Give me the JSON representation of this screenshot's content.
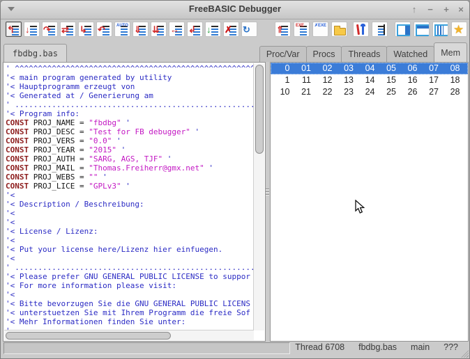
{
  "window": {
    "title": "FreeBASIC Debugger",
    "controls": {
      "shade": "↑",
      "minimize": "−",
      "maximize": "+",
      "close": "×"
    }
  },
  "toolbar": {
    "buttons": [
      {
        "name": "current-statement-button",
        "kind": "bars",
        "glyph": "↰",
        "color": "#d22b2b",
        "pressed": true
      },
      {
        "name": "step-into-button",
        "kind": "bars",
        "glyph": "↓",
        "color": "#d22b2b"
      },
      {
        "name": "step-over-button",
        "kind": "bars",
        "glyph": "↷",
        "color": "#d22b2b"
      },
      {
        "name": "step-multi-button",
        "kind": "bars",
        "glyph": "⇄",
        "color": "#d22b2b"
      },
      {
        "name": "step-to-line-button",
        "kind": "bars",
        "glyph": "↳",
        "color": "#d22b2b"
      },
      {
        "name": "step-return-button",
        "kind": "bars",
        "glyph": "↶",
        "color": "#d22b2b"
      },
      {
        "name": "auto-step-button",
        "kind": "bars",
        "glyph": "AUTO",
        "color": "#2b62d9",
        "small": true
      },
      {
        "name": "run-button",
        "kind": "bars",
        "glyph": "⇓",
        "color": "#d22b2b"
      },
      {
        "name": "run-to-cursor-button",
        "kind": "bars",
        "glyph": "⇊",
        "color": "#d22b2b"
      },
      {
        "name": "run-until-return-button",
        "kind": "bars",
        "glyph": "↔",
        "color": "#d22b2b"
      },
      {
        "name": "step-out-button",
        "kind": "bars",
        "glyph": "↲",
        "color": "#d22b2b"
      },
      {
        "name": "continue-run-button",
        "kind": "bars",
        "glyph": "↓",
        "color": "#1f9e3a"
      },
      {
        "name": "stop-debugging-button",
        "kind": "bars",
        "glyph": "✗",
        "color": "#cc1111"
      },
      {
        "name": "restart-button",
        "kind": "plain",
        "glyph": "↻",
        "color": "#2b73c8"
      },
      {
        "name": "attach-process-button",
        "kind": "bars",
        "glyph": "⇑",
        "color": "#d22b2b"
      },
      {
        "name": "run-exe-button",
        "kind": "bars",
        "glyph": "EXE",
        "color": "#d22b2b",
        "small": true
      },
      {
        "name": "kill-exe-button",
        "kind": "plain",
        "glyph": "✗EXE",
        "color": "#2b62d9",
        "small": true
      },
      {
        "name": "open-file-button",
        "kind": "folder"
      },
      {
        "name": "settings-tools-button",
        "kind": "tools"
      },
      {
        "name": "log-options-button",
        "kind": "notes"
      },
      {
        "name": "layout-right-pane-button",
        "kind": "win",
        "variant": "right"
      },
      {
        "name": "layout-top-pane-button",
        "kind": "win",
        "variant": "top"
      },
      {
        "name": "layout-columns-button",
        "kind": "win",
        "variant": "cols"
      },
      {
        "name": "favorites-button",
        "kind": "star",
        "glyph": "★"
      }
    ]
  },
  "tabs": {
    "source": {
      "label": "fbdbg.bas"
    },
    "right": [
      {
        "label": "Proc/Var",
        "active": false
      },
      {
        "label": "Procs",
        "active": false
      },
      {
        "label": "Threads",
        "active": false
      },
      {
        "label": "Watched",
        "active": false
      },
      {
        "label": "Mem",
        "active": true
      }
    ]
  },
  "editor": {
    "lines": [
      [
        [
          "com",
          "' ^^^^^^^^^^^^^^^^^^^^^^^^^^^^^^^^^^^^^^^^^^^^^^^^^^^^^^^^^^^^^^^^^^^^"
        ]
      ],
      [
        [
          "com",
          "'< main program generated by utility"
        ]
      ],
      [
        [
          "com",
          "'< Hauptprogramm erzeugt von"
        ]
      ],
      [
        [
          "com",
          "'< Generated at / Generierung am"
        ]
      ],
      [
        [
          "com",
          "' ......................................................................"
        ]
      ],
      [
        [
          "com",
          "'< Program info:"
        ]
      ],
      [
        [
          "kw",
          "CONST"
        ],
        [
          "txt",
          " PROJ_NAME = "
        ],
        [
          "str",
          "\"fbdbg\""
        ],
        [
          "com",
          " '"
        ]
      ],
      [
        [
          "kw",
          "CONST"
        ],
        [
          "txt",
          " PROJ_DESC = "
        ],
        [
          "str",
          "\"Test for FB debugger\""
        ],
        [
          "com",
          " '"
        ]
      ],
      [
        [
          "kw",
          "CONST"
        ],
        [
          "txt",
          " PROJ_VERS = "
        ],
        [
          "str",
          "\"0.0\""
        ],
        [
          "com",
          " '"
        ]
      ],
      [
        [
          "kw",
          "CONST"
        ],
        [
          "txt",
          " PROJ_YEAR = "
        ],
        [
          "str",
          "\"2015\""
        ],
        [
          "com",
          " '"
        ]
      ],
      [
        [
          "kw",
          "CONST"
        ],
        [
          "txt",
          " PROJ_AUTH = "
        ],
        [
          "str",
          "\"SARG, AGS, TJF\""
        ],
        [
          "com",
          " '"
        ]
      ],
      [
        [
          "kw",
          "CONST"
        ],
        [
          "txt",
          " PROJ_MAIL = "
        ],
        [
          "str",
          "\"Thomas.Freiherr@gmx.net\""
        ],
        [
          "com",
          " '"
        ]
      ],
      [
        [
          "kw",
          "CONST"
        ],
        [
          "txt",
          " PROJ_WEBS = "
        ],
        [
          "str",
          "\"\""
        ],
        [
          "com",
          " '"
        ]
      ],
      [
        [
          "kw",
          "CONST"
        ],
        [
          "txt",
          " PROJ_LICE = "
        ],
        [
          "str",
          "\"GPLv3\""
        ],
        [
          "com",
          " '"
        ]
      ],
      [
        [
          "com",
          "'<"
        ]
      ],
      [
        [
          "com",
          "'< Description / Beschreibung:"
        ]
      ],
      [
        [
          "com",
          "'<"
        ]
      ],
      [
        [
          "com",
          "'<"
        ]
      ],
      [
        [
          "com",
          "'< License / Lizenz:"
        ]
      ],
      [
        [
          "com",
          "'<"
        ]
      ],
      [
        [
          "com",
          "'< Put your license here/Lizenz hier einfuegen."
        ]
      ],
      [
        [
          "com",
          "'<"
        ]
      ],
      [
        [
          "com",
          "' ......................................................................"
        ]
      ],
      [
        [
          "com",
          "'< Please prefer GNU GENERAL PUBLIC LICENSE to suppor"
        ]
      ],
      [
        [
          "com",
          "'< For more information please visit:"
        ]
      ],
      [
        [
          "com",
          "'<"
        ]
      ],
      [
        [
          "com",
          "'< Bitte bevorzugen Sie die GNU GENERAL PUBLIC LICENS"
        ]
      ],
      [
        [
          "com",
          "'< unterstuetzen Sie mit Ihrem Programm die freie Sof"
        ]
      ],
      [
        [
          "com",
          "'< Mehr Informationen finden Sie unter:"
        ]
      ],
      [
        [
          "com",
          "' ......................................................................"
        ]
      ]
    ]
  },
  "mem": {
    "rows": [
      {
        "cells": [
          "0",
          "01",
          "02",
          "03",
          "04",
          "05",
          "06",
          "07",
          "08"
        ],
        "selected": true
      },
      {
        "cells": [
          "1",
          "11",
          "12",
          "13",
          "14",
          "15",
          "16",
          "17",
          "18"
        ],
        "selected": false
      },
      {
        "cells": [
          "10",
          "21",
          "22",
          "23",
          "24",
          "25",
          "26",
          "27",
          "28"
        ],
        "selected": false
      }
    ]
  },
  "statusbar": {
    "fields": [
      "Thread 6708",
      "fbdbg.bas",
      "main",
      "???"
    ]
  },
  "colors": {
    "selection": "#3b7cd8",
    "comment": "#2b2bc4",
    "keyword": "#8f2020",
    "string": "#c318c3",
    "star": "#f2b32c"
  }
}
